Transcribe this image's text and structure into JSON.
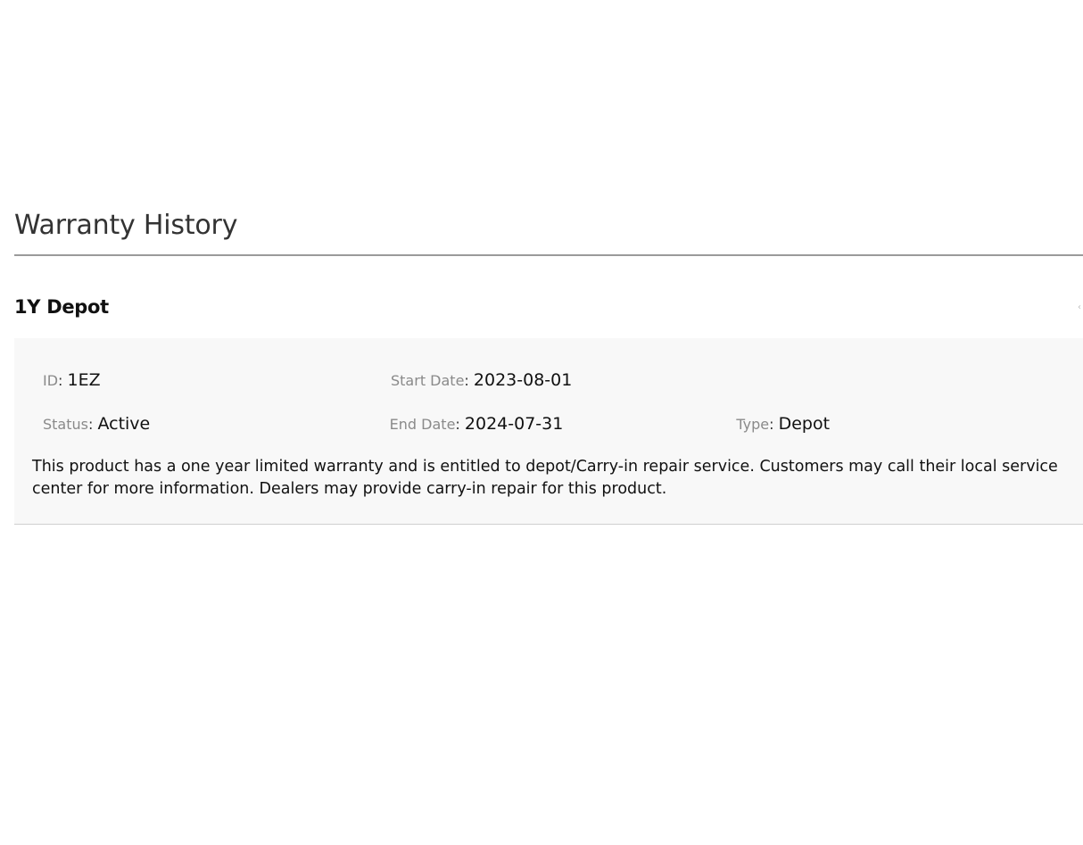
{
  "section": {
    "title": "Warranty History"
  },
  "warranty": {
    "name": "1Y Depot",
    "fields": {
      "id_label": "ID",
      "id_value": "1EZ",
      "start_label": "Start Date",
      "start_value": "2023-08-01",
      "status_label": "Status",
      "status_value": "Active",
      "end_label": "End Date",
      "end_value": "2024-07-31",
      "type_label": "Type",
      "type_value": "Depot"
    },
    "description": "This product has a one year limited warranty and is entitled to depot/Carry-in repair service. Customers may call their local service center for more information. Dealers may provide carry-in repair for this product."
  },
  "icons": {
    "collapse": "chevron-left-icon"
  },
  "colors": {
    "body_bg": "#f8f8f8",
    "label": "#8a8a8a",
    "rule": "#9a9a9a"
  }
}
